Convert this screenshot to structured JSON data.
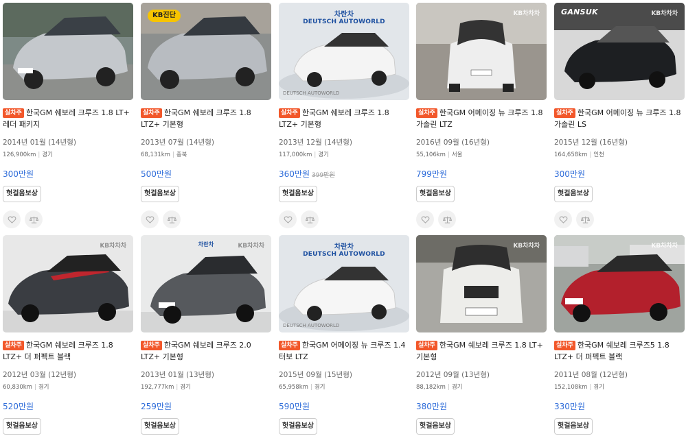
{
  "labels": {
    "badge": "실차주",
    "compensation": "헛걸음보상"
  },
  "overlays": {
    "kb_diag": "KB진단",
    "kb_wm": "KB차차차",
    "deutsch_top": "차란차",
    "deutsch_brand": "DEUTSCH AUTOWORLD",
    "deutsch_bottom": "DEUTSCH AUTOWORLD",
    "gansuk": "GANSUK"
  },
  "cars": [
    {
      "title": "한국GM 쉐보레 크루즈 1.8 LT+ 레더 패키지",
      "year": "2014년 01월 (14년형)",
      "mileage": "126,900km",
      "region": "경기",
      "price": "300만원",
      "old_price": "",
      "color": "#c4c8cc",
      "icon_like": "heart-icon",
      "icon_compare": "scale-icon"
    },
    {
      "title": "한국GM 쉐보레 크루즈 1.8 LTZ+ 기본형",
      "year": "2013년 07월 (14년형)",
      "mileage": "68,131km",
      "region": "충북",
      "price": "500만원",
      "old_price": "",
      "color": "#b8bcc1",
      "icon_like": "heart-icon",
      "icon_compare": "scale-icon"
    },
    {
      "title": "한국GM 쉐보레 크루즈 1.8 LTZ+ 기본형",
      "year": "2013년 12월 (14년형)",
      "mileage": "117,000km",
      "region": "경기",
      "price": "360만원",
      "old_price": "399만원",
      "color": "#f4f4f4",
      "icon_like": "heart-icon",
      "icon_compare": "scale-icon"
    },
    {
      "title": "한국GM 어메이징 뉴 크루즈 1.8 가솔린 LTZ",
      "year": "2016년 09월 (16년형)",
      "mileage": "55,106km",
      "region": "서울",
      "price": "799만원",
      "old_price": "",
      "color": "#eeeeee",
      "icon_like": "heart-icon",
      "icon_compare": "scale-icon"
    },
    {
      "title": "한국GM 어메이징 뉴 크루즈 1.8 가솔린 LS",
      "year": "2015년 12월 (16년형)",
      "mileage": "164,658km",
      "region": "인천",
      "price": "300만원",
      "old_price": "",
      "color": "#1d1f22",
      "icon_like": "heart-icon",
      "icon_compare": "scale-icon"
    },
    {
      "title": "한국GM 쉐보레 크루즈 1.8 LTZ+ 더 퍼펙트 블랙",
      "year": "2012년 03월 (12년형)",
      "mileage": "60,830km",
      "region": "경기",
      "price": "520만원",
      "old_price": "",
      "color": "#3a3d42",
      "icon_like": "heart-icon",
      "icon_compare": "scale-icon"
    },
    {
      "title": "한국GM 쉐보레 크루즈 2.0 LTZ+ 기본형",
      "year": "2013년 01월 (13년형)",
      "mileage": "192,777km",
      "region": "경기",
      "price": "259만원",
      "old_price": "",
      "color": "#56595d",
      "icon_like": "heart-icon",
      "icon_compare": "scale-icon"
    },
    {
      "title": "한국GM 어메이징 뉴 크루즈 1.4 터보 LTZ",
      "year": "2015년 09월 (15년형)",
      "mileage": "65,958km",
      "region": "경기",
      "price": "590만원",
      "old_price": "",
      "color": "#f6f6f6",
      "icon_like": "heart-icon",
      "icon_compare": "scale-icon"
    },
    {
      "title": "한국GM 쉐보레 크루즈 1.8 LT+ 기본형",
      "year": "2012년 09월 (13년형)",
      "mileage": "88,182km",
      "region": "경기",
      "price": "380만원",
      "old_price": "",
      "color": "#ededea",
      "icon_like": "heart-icon",
      "icon_compare": "scale-icon"
    },
    {
      "title": "한국GM 쉐보레 크루즈5 1.8 LTZ+ 더 퍼펙트 블랙",
      "year": "2011년 08월 (12년형)",
      "mileage": "152,108km",
      "region": "경기",
      "price": "330만원",
      "old_price": "",
      "color": "#b3202c",
      "icon_like": "heart-icon",
      "icon_compare": "scale-icon"
    }
  ]
}
